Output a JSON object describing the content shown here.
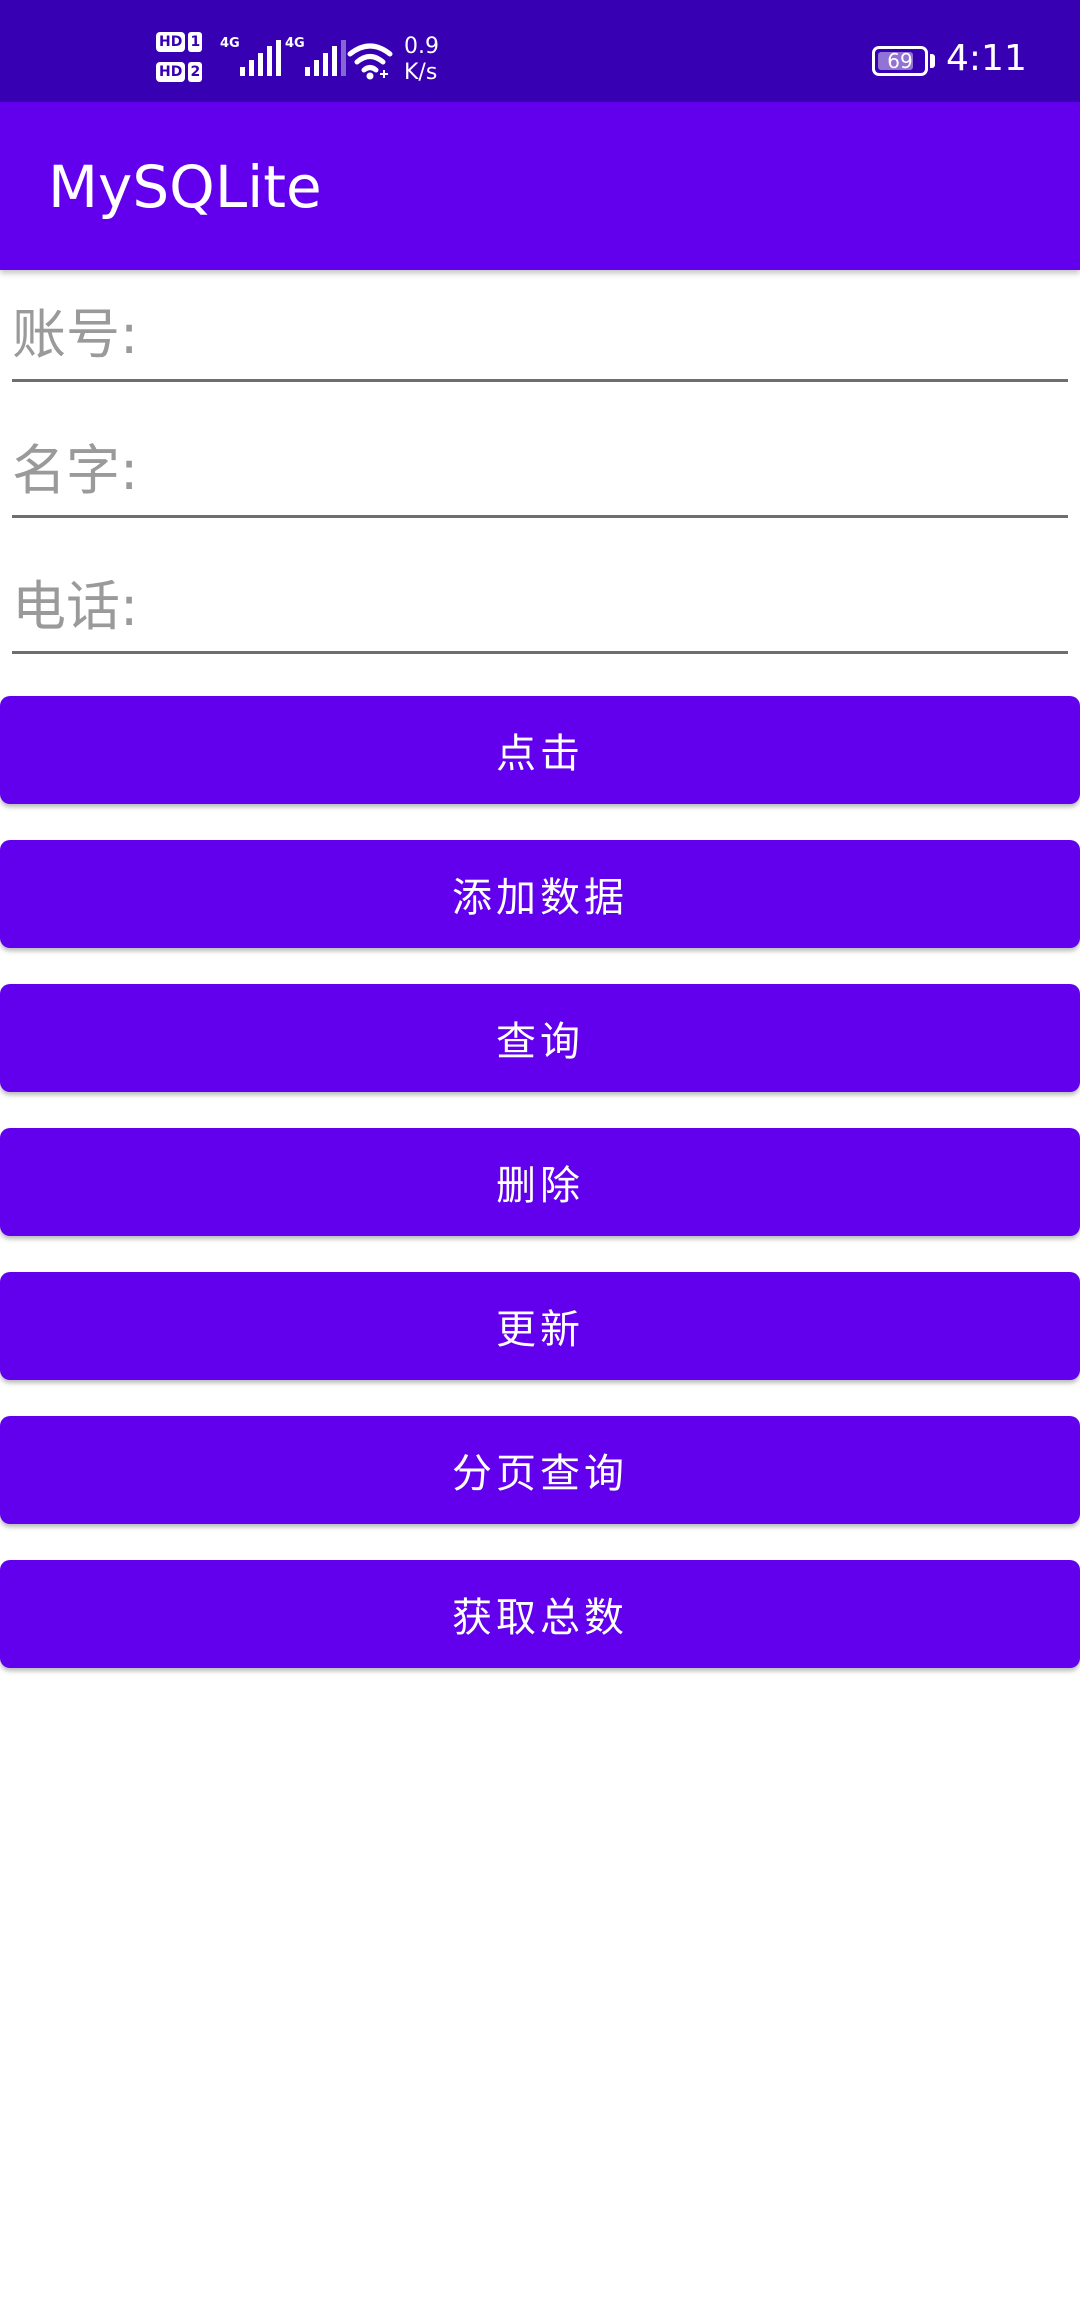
{
  "status_bar": {
    "hd_label": "HD",
    "sim1": "1",
    "sim2": "2",
    "network_type_1": "4G",
    "network_type_2": "4G",
    "net_speed_value": "0.9",
    "net_speed_unit": "K/s",
    "battery_level": "69",
    "time": "4:11"
  },
  "app_bar": {
    "title": "MySQLite"
  },
  "form": {
    "account_placeholder": "账号:",
    "name_placeholder": "名字:",
    "phone_placeholder": "电话:"
  },
  "buttons": {
    "click": "点击",
    "add_data": "添加数据",
    "query": "查询",
    "delete": "删除",
    "update": "更新",
    "paged_query": "分页查询",
    "get_total": "获取总数"
  },
  "colors": {
    "status_bar": "#3700b3",
    "primary": "#6200ee",
    "background": "#ffffff",
    "placeholder": "#9a9a9a",
    "underline": "#6e6e6e"
  }
}
